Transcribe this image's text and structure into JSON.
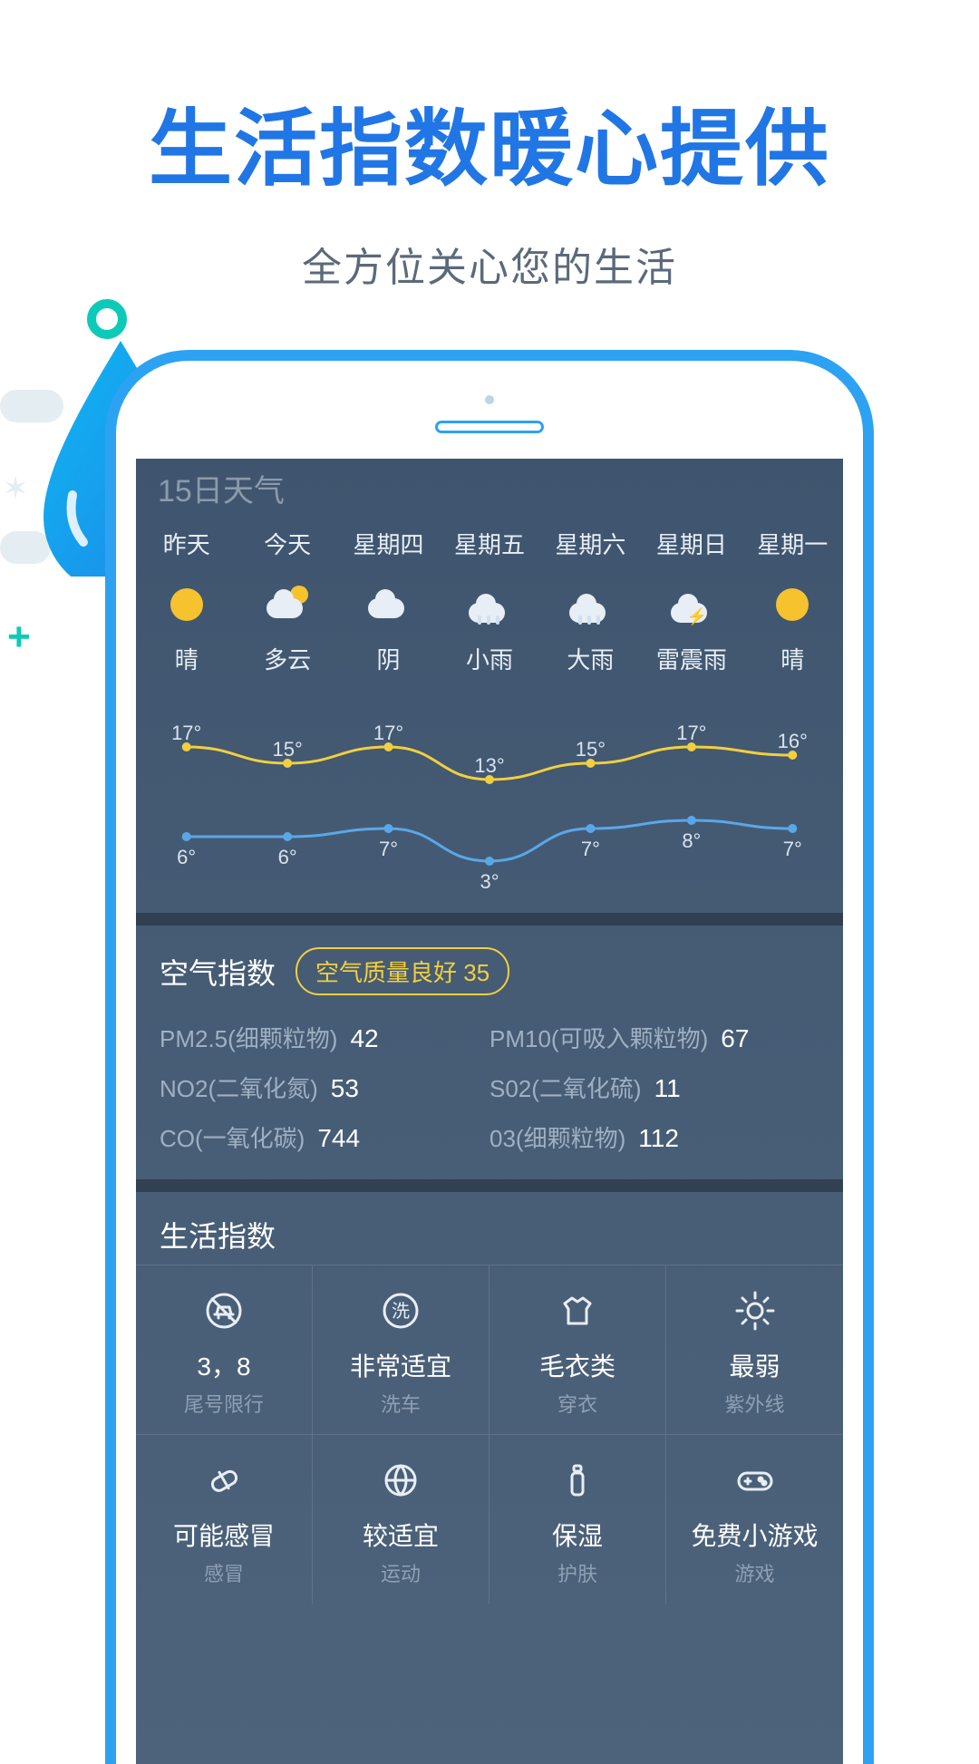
{
  "headline": {
    "title": "生活指数暖心提供",
    "subtitle": "全方位关心您的生活"
  },
  "forecast": {
    "section_title": "15日天气",
    "days": [
      {
        "label": "昨天",
        "icon": "sun",
        "cond": "晴",
        "hi": 17,
        "lo": 6
      },
      {
        "label": "今天",
        "icon": "cloud-sun",
        "cond": "多云",
        "hi": 15,
        "lo": 6
      },
      {
        "label": "星期四",
        "icon": "cloud",
        "cond": "阴",
        "hi": 17,
        "lo": 7
      },
      {
        "label": "星期五",
        "icon": "rain",
        "cond": "小雨",
        "hi": 13,
        "lo": 3
      },
      {
        "label": "星期六",
        "icon": "rain",
        "cond": "大雨",
        "hi": 15,
        "lo": 7
      },
      {
        "label": "星期日",
        "icon": "storm",
        "cond": "雷震雨",
        "hi": 17,
        "lo": 8
      },
      {
        "label": "星期一",
        "icon": "sun",
        "cond": "晴",
        "hi": 16,
        "lo": 7
      }
    ]
  },
  "air_quality": {
    "title": "空气指数",
    "badge": "空气质量良好 35",
    "items": [
      {
        "k": "PM2.5(细颗粒物)",
        "v": "42"
      },
      {
        "k": "PM10(可吸入颗粒物)",
        "v": "67"
      },
      {
        "k": "NO2(二氧化氮)",
        "v": "53"
      },
      {
        "k": "S02(二氧化硫)",
        "v": "11"
      },
      {
        "k": "CO(一氧化碳)",
        "v": "744"
      },
      {
        "k": "03(细颗粒物)",
        "v": "112"
      }
    ]
  },
  "life_index": {
    "title": "生活指数",
    "items": [
      {
        "icon": "car-no",
        "value": "3，8",
        "sub": "尾号限行"
      },
      {
        "icon": "wash",
        "value": "非常适宜",
        "sub": "洗车"
      },
      {
        "icon": "shirt",
        "value": "毛衣类",
        "sub": "穿衣"
      },
      {
        "icon": "sun-uv",
        "value": "最弱",
        "sub": "紫外线"
      },
      {
        "icon": "pill",
        "value": "可能感冒",
        "sub": "感冒"
      },
      {
        "icon": "ball",
        "value": "较适宜",
        "sub": "运动"
      },
      {
        "icon": "lotion",
        "value": "保湿",
        "sub": "护肤"
      },
      {
        "icon": "gamepad",
        "value": "免费小游戏",
        "sub": "游戏"
      }
    ]
  },
  "chart_data": {
    "type": "line",
    "categories": [
      "昨天",
      "今天",
      "星期四",
      "星期五",
      "星期六",
      "星期日",
      "星期一"
    ],
    "series": [
      {
        "name": "high",
        "values": [
          17,
          15,
          17,
          13,
          15,
          17,
          16
        ],
        "color": "#f2cf3e"
      },
      {
        "name": "low",
        "values": [
          6,
          6,
          7,
          3,
          7,
          8,
          7
        ],
        "color": "#5aa7e8"
      }
    ],
    "ylim": [
      0,
      20
    ]
  }
}
